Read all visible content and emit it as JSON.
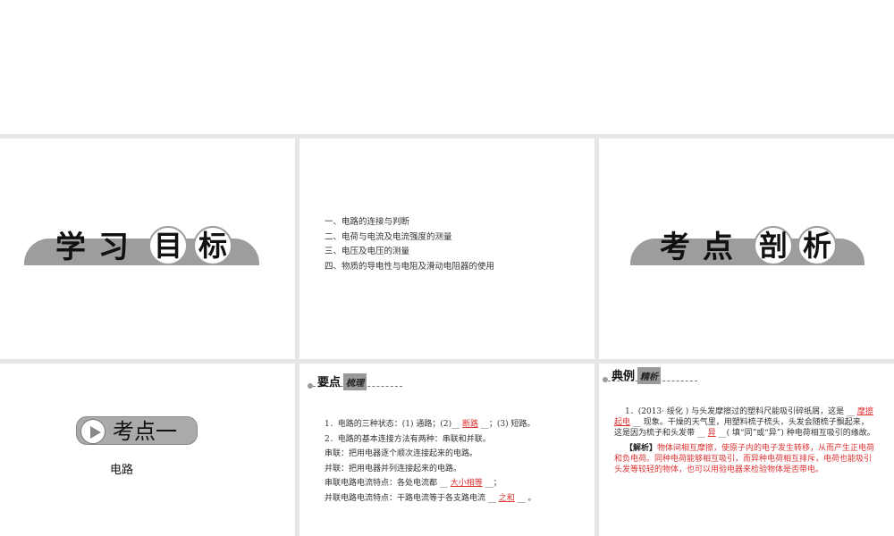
{
  "slide1": {
    "chars": [
      "学",
      "习",
      "目",
      "标"
    ]
  },
  "slide2": {
    "items": [
      "一、电路的连接与判断",
      "二、电荷与电流及电流强度的测量",
      "三、电压及电压的测量",
      "四、物质的导电性与电阻及滑动电阻器的使用"
    ]
  },
  "slide3": {
    "chars": [
      "考",
      "点",
      "剖",
      "析"
    ]
  },
  "slide4": {
    "badge": "考点一",
    "topic": "电路"
  },
  "slide5": {
    "heading": "要点",
    "heading_box": "梳理",
    "l1a": "1．电路的三种状态：(1) 通路；(2)__ ",
    "l1ans": "断路",
    "l1b": " __；(3) 短路。",
    "l2": "2．电路的基本连接方法有两种：串联和并联。",
    "l3": "串联：把用电器逐个顺次连接起来的电路。",
    "l4": "并联：把用电器并列连接起来的电路。",
    "l5a": "串联电路电流特点：各处电流都 __ ",
    "l5ans": "大小相等",
    "l5b": " __；",
    "l6a": "并联电路电流特点：干路电流等于各支路电流 __ ",
    "l6ans": "之和",
    "l6b": " __ 。"
  },
  "slide6": {
    "heading": "典例",
    "heading_box": "精析",
    "q1": "1．(2013· 绥化 ) 与头发摩擦过的塑料尺能吸引碎纸屑，这是 __ ",
    "ans1": "摩擦起电",
    "q2": " __ 现象。干燥的天气里，用塑料梳子梳头，头发会随梳子飘起来，这是因为梳子和头发带 __ ",
    "ans2": "异",
    "q3": " __( 填“同”或“异”) 种电荷相互吸引的缘故。",
    "analysis_label": "【解析】",
    "analysis": "物体间相互摩擦，使原子内的电子发生转移，从而产生正电荷和负电荷。同种电荷能够相互吸引，而异种电荷相互排斥，电荷也能吸引头发等较轻的物体，也可以用验电器来检验物体是否带电。"
  }
}
